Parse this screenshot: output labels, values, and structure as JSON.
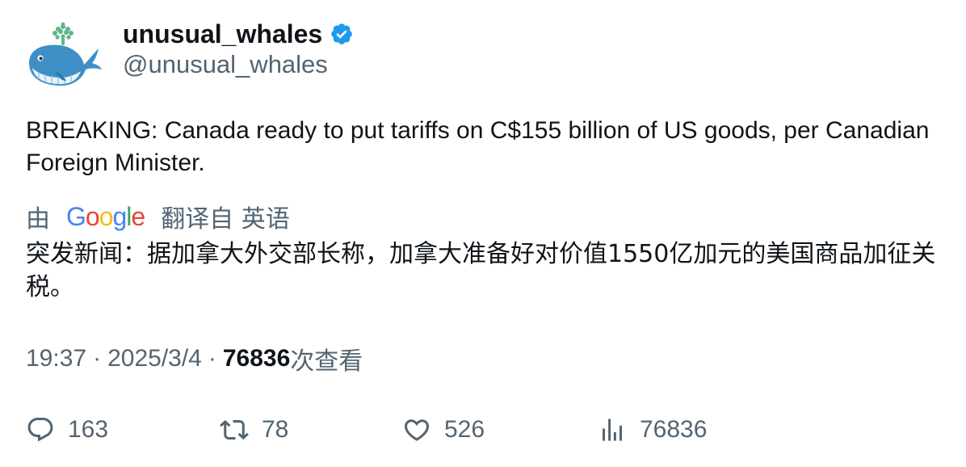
{
  "author": {
    "display_name": "unusual_whales",
    "handle": "@unusual_whales",
    "verified": true,
    "avatar_icon": "whale-avatar-icon",
    "verified_color": "#1d9bf0"
  },
  "tweet": {
    "text": "BREAKING: Canada ready to put tariffs on C$155 billion of US goods, per Canadian Foreign Minister."
  },
  "translation": {
    "prefix": "由",
    "provider_letters": [
      "G",
      "o",
      "o",
      "g",
      "l",
      "e"
    ],
    "provider_colors": [
      "#4285f4",
      "#ea4335",
      "#fbbc05",
      "#4285f4",
      "#34a853",
      "#ea4335"
    ],
    "suffix": "翻译自 英语",
    "text": "突发新闻：据加拿大外交部长称，加拿大准备好对价值1550亿加元的美国商品加征关税。"
  },
  "meta": {
    "time": "19:37",
    "date": "2025/3/4",
    "separator": "·",
    "views_count": "76836",
    "views_label": "次查看"
  },
  "actions": {
    "replies": "163",
    "retweets": "78",
    "likes": "526",
    "views": "76836"
  },
  "colors": {
    "text_primary": "#0f1419",
    "text_secondary": "#536471"
  }
}
